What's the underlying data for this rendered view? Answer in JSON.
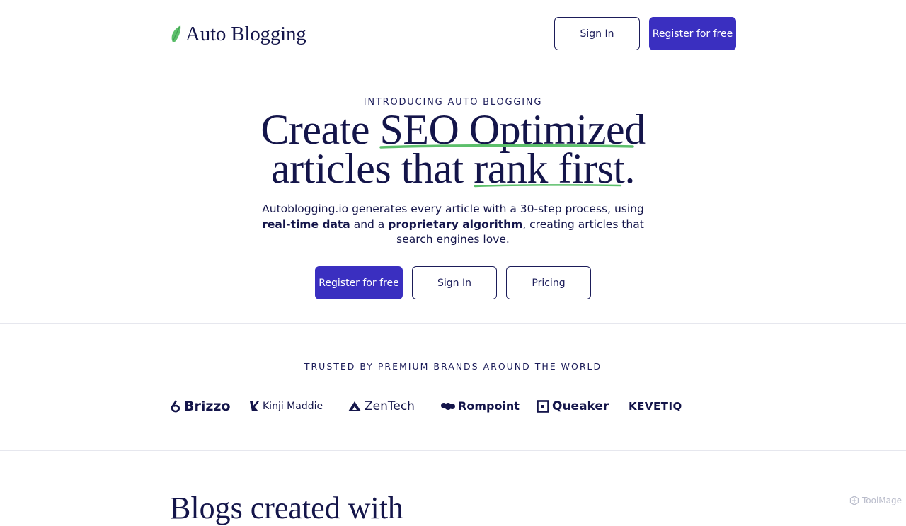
{
  "header": {
    "brand": "Auto Blogging",
    "sign_in": "Sign In",
    "register": "Register for free"
  },
  "hero": {
    "eyebrow": "INTRODUCING AUTO BLOGGING",
    "headline_line1_a": "Create ",
    "headline_line1_b": "SEO Optimized",
    "headline_line2_a": "articles that ",
    "headline_line2_b": "rank first.",
    "sub_part1": "Autoblogging.io generates every article with a 30-step process, using ",
    "sub_bold1": "real-time data",
    "sub_part2": " and a ",
    "sub_bold2": "proprietary algorithm",
    "sub_part3": ", creating articles that search engines love.",
    "cta_register": "Register for free",
    "cta_sign_in": "Sign In",
    "cta_pricing": "Pricing"
  },
  "trusted": {
    "label": "TRUSTED BY PREMIUM BRANDS AROUND THE WORLD",
    "logos": [
      "Brizzo",
      "Kinji Maddie",
      "ZenTech",
      "Rompoint",
      "Queaker",
      "KEVETIQ"
    ]
  },
  "next_section": {
    "title": "Blogs created with"
  },
  "watermark": "ToolMage",
  "colors": {
    "navy": "#14154a",
    "accent": "#3a2fc0",
    "green": "#5cbf6b"
  }
}
